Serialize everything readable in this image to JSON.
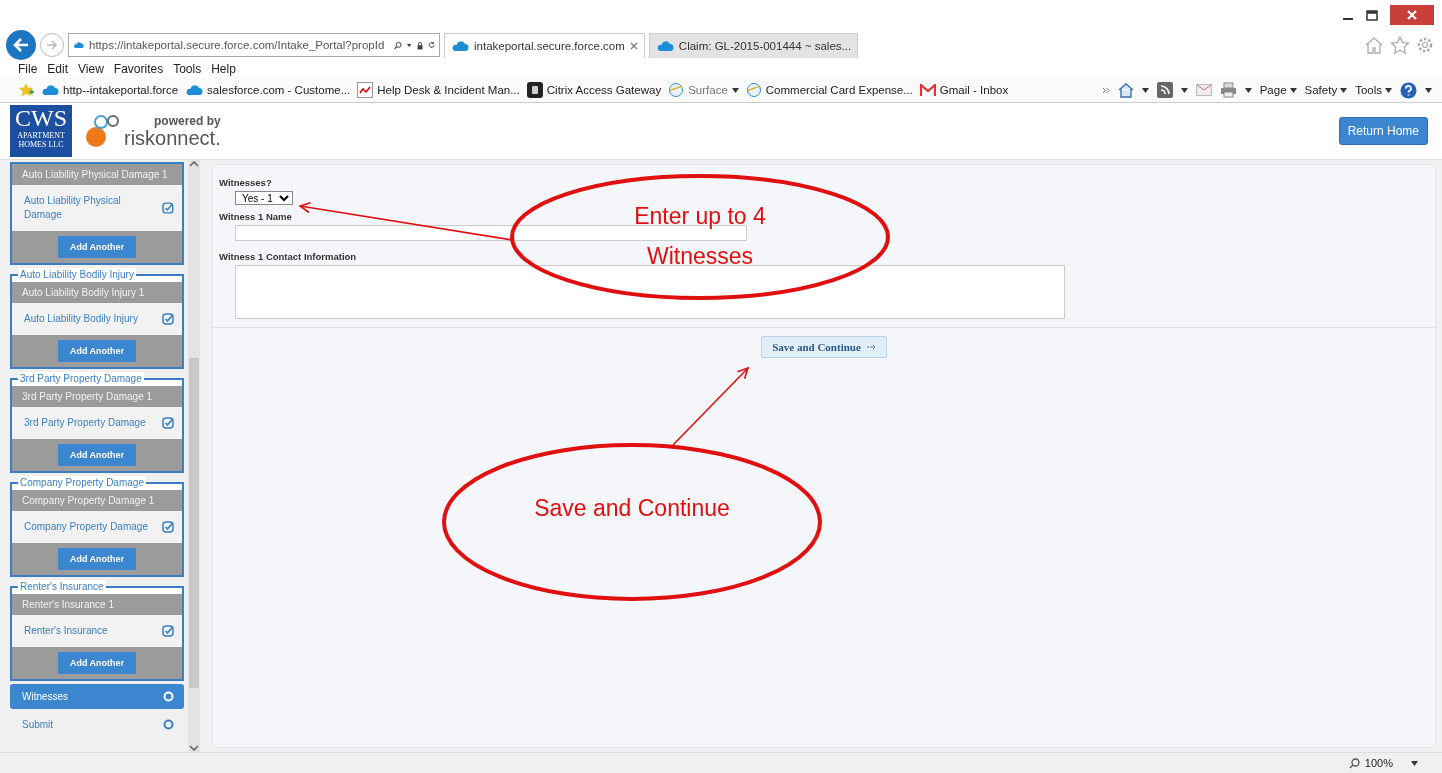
{
  "browser": {
    "address": "https://intakeportal.secure.force.com/Intake_Portal?propId",
    "tabs": [
      {
        "label": "intakeportal.secure.force.com",
        "selected": true
      },
      {
        "label": "Claim: GL-2015-001444 ~ sales...",
        "selected": false
      }
    ],
    "menu": [
      "File",
      "Edit",
      "View",
      "Favorites",
      "Tools",
      "Help"
    ],
    "favorites": [
      {
        "label": "http--intakeportal.force",
        "kind": "cloud"
      },
      {
        "label": "salesforce.com - Custome...",
        "kind": "cloud"
      },
      {
        "label": "Help Desk & Incident Man...",
        "kind": "chart"
      },
      {
        "label": "Citrix Access Gateway",
        "kind": "citrix"
      },
      {
        "label": "Surface",
        "kind": "folder"
      },
      {
        "label": "Commercial Card Expense...",
        "kind": "ie"
      },
      {
        "label": "Gmail - Inbox",
        "kind": "gmail"
      }
    ],
    "commands": [
      "Page",
      "Safety",
      "Tools"
    ],
    "zoom": "100%"
  },
  "header": {
    "logo": "CWS",
    "logo_sub": "APARTMENT HOMES LLC",
    "powered_by": "powered by",
    "brand": "riskonnect.",
    "return_button": "Return Home"
  },
  "sidebar": {
    "groups": [
      {
        "subheader": "Auto Liability Physical Damage 1",
        "item": "Auto Liability Physical Damage",
        "complete": true,
        "button": "Add Another"
      },
      {
        "title": "Auto Liability Bodily Injury",
        "subheader": "Auto Liability Bodily Injury 1",
        "item": "Auto Liability Bodily Injury",
        "complete": true,
        "button": "Add Another"
      },
      {
        "title": "3rd Party Property Damage",
        "subheader": "3rd Party Property Damage 1",
        "item": "3rd Party Property Damage",
        "complete": true,
        "button": "Add Another"
      },
      {
        "title": "Company Property Damage",
        "subheader": "Company Property Damage 1",
        "item": "Company Property Damage",
        "complete": true,
        "button": "Add Another"
      },
      {
        "title": "Renter's Insurance",
        "subheader": "Renter's Insurance 1",
        "item": "Renter's Insurance",
        "complete": true,
        "button": "Add Another"
      }
    ],
    "nav": [
      {
        "label": "Witnesses",
        "selected": true,
        "complete": false
      },
      {
        "label": "Submit",
        "selected": false,
        "complete": false
      }
    ]
  },
  "form": {
    "witnesses_label": "Witnesses?",
    "witnesses_value": "Yes - 1",
    "name_label": "Witness 1 Name",
    "contact_label": "Witness 1 Contact Information",
    "save_button": "Save and Continue"
  },
  "annotations": [
    {
      "text": "Enter up to 4 Witnesses"
    },
    {
      "text": "Save and Continue"
    }
  ]
}
